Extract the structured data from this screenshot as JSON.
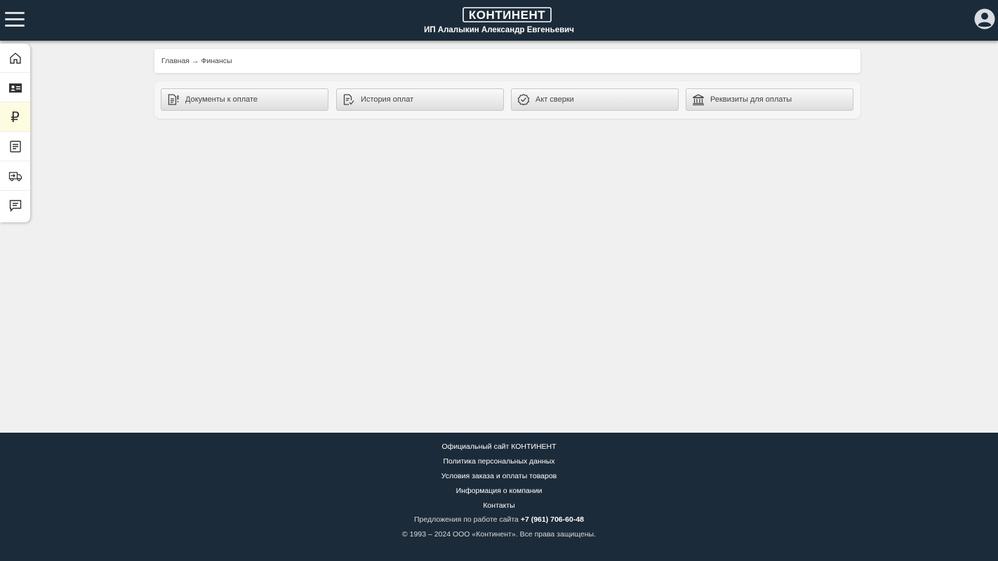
{
  "header": {
    "logo_text": "КОНТИНЕНТ",
    "company_name": "ИП Алалыкин Александр Евгеньевич",
    "menu_icon": "hamburger-icon",
    "avatar_icon": "user-circle-icon"
  },
  "sidenav": {
    "items": [
      {
        "icon": "home-icon"
      },
      {
        "icon": "id-card-icon"
      },
      {
        "icon": "ruble-icon",
        "symbol": "₽",
        "active": true
      },
      {
        "icon": "document-list-icon"
      },
      {
        "icon": "truck-icon"
      },
      {
        "icon": "chat-icon"
      }
    ],
    "active_color": "#fdfce0"
  },
  "breadcrumb": {
    "home": "Главная",
    "separator": "→",
    "current": "Финансы"
  },
  "buttons": [
    {
      "label": "Документы к оплате",
      "icon": "document-alert-icon"
    },
    {
      "label": "История оплат",
      "icon": "document-check-icon"
    },
    {
      "label": "Акт сверки",
      "icon": "verified-badge-icon"
    },
    {
      "label": "Реквизиты для оплаты",
      "icon": "bank-icon"
    }
  ],
  "footer": {
    "links": [
      "Официальный сайт КОНТИНЕНТ",
      "Политика персональных данных",
      "Условия заказа и оплаты товаров",
      "Информация о компании",
      "Контакты"
    ],
    "suggestions_text": "Предложения по работе сайта",
    "phone": "+7 (961) 706-60-48",
    "copyright": "© 1993 – 2024 ООО «Континент». Все права защищены."
  },
  "colors": {
    "header_bg": "#1c2b39",
    "page_bg": "#f0f0f0"
  }
}
